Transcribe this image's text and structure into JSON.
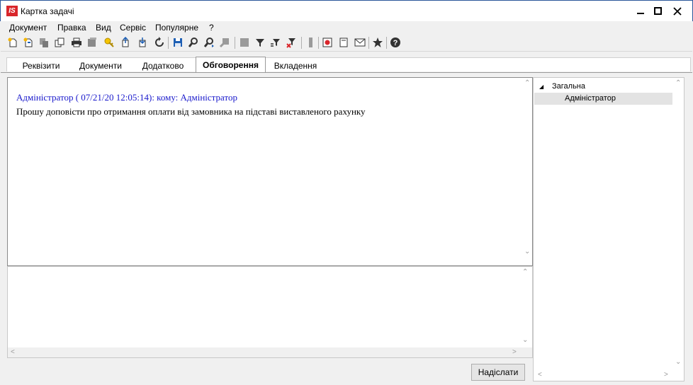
{
  "window": {
    "title": "Картка задачі",
    "logo_text": "IS",
    "border_color": "#2b579a"
  },
  "menu": {
    "items": [
      "Документ",
      "Правка",
      "Вид",
      "Сервіс",
      "Популярне",
      "?"
    ]
  },
  "toolbar": {
    "icons": [
      "new-doc-icon",
      "new-copy-icon",
      "copy-gray-icon",
      "duplicate-icon",
      "print-icon",
      "gray-stack-icon",
      "key-icon",
      "export-icon",
      "import-icon",
      "refresh-icon",
      "save-icon",
      "find-icon",
      "find-next-icon",
      "gray-pin-icon",
      "gray-square-icon",
      "filter-icon",
      "filter-edit-icon",
      "filter-clear-icon",
      "gray-bar-icon",
      "record-icon",
      "form-icon",
      "mail-icon",
      "favorite-star-icon",
      "help-icon"
    ]
  },
  "tabs": [
    {
      "label": "Реквізити",
      "active": false
    },
    {
      "label": "Документи",
      "active": false
    },
    {
      "label": "Додатково",
      "active": false
    },
    {
      "label": "Обговорення",
      "active": true
    },
    {
      "label": "Вкладення",
      "active": false
    }
  ],
  "discussion": {
    "message_header": "Адміністратор ( 07/21/20 12:05:14): кому: Адміністратор",
    "message_body": "Прошу доповісти про отримання оплати від замовника на підставі виставленого рахунку",
    "header_color": "#1a1acc"
  },
  "compose": {
    "value": "",
    "send_label": "Надіслати"
  },
  "recipients": {
    "group_label": "Загальна",
    "items": [
      "Адміністратор"
    ]
  }
}
